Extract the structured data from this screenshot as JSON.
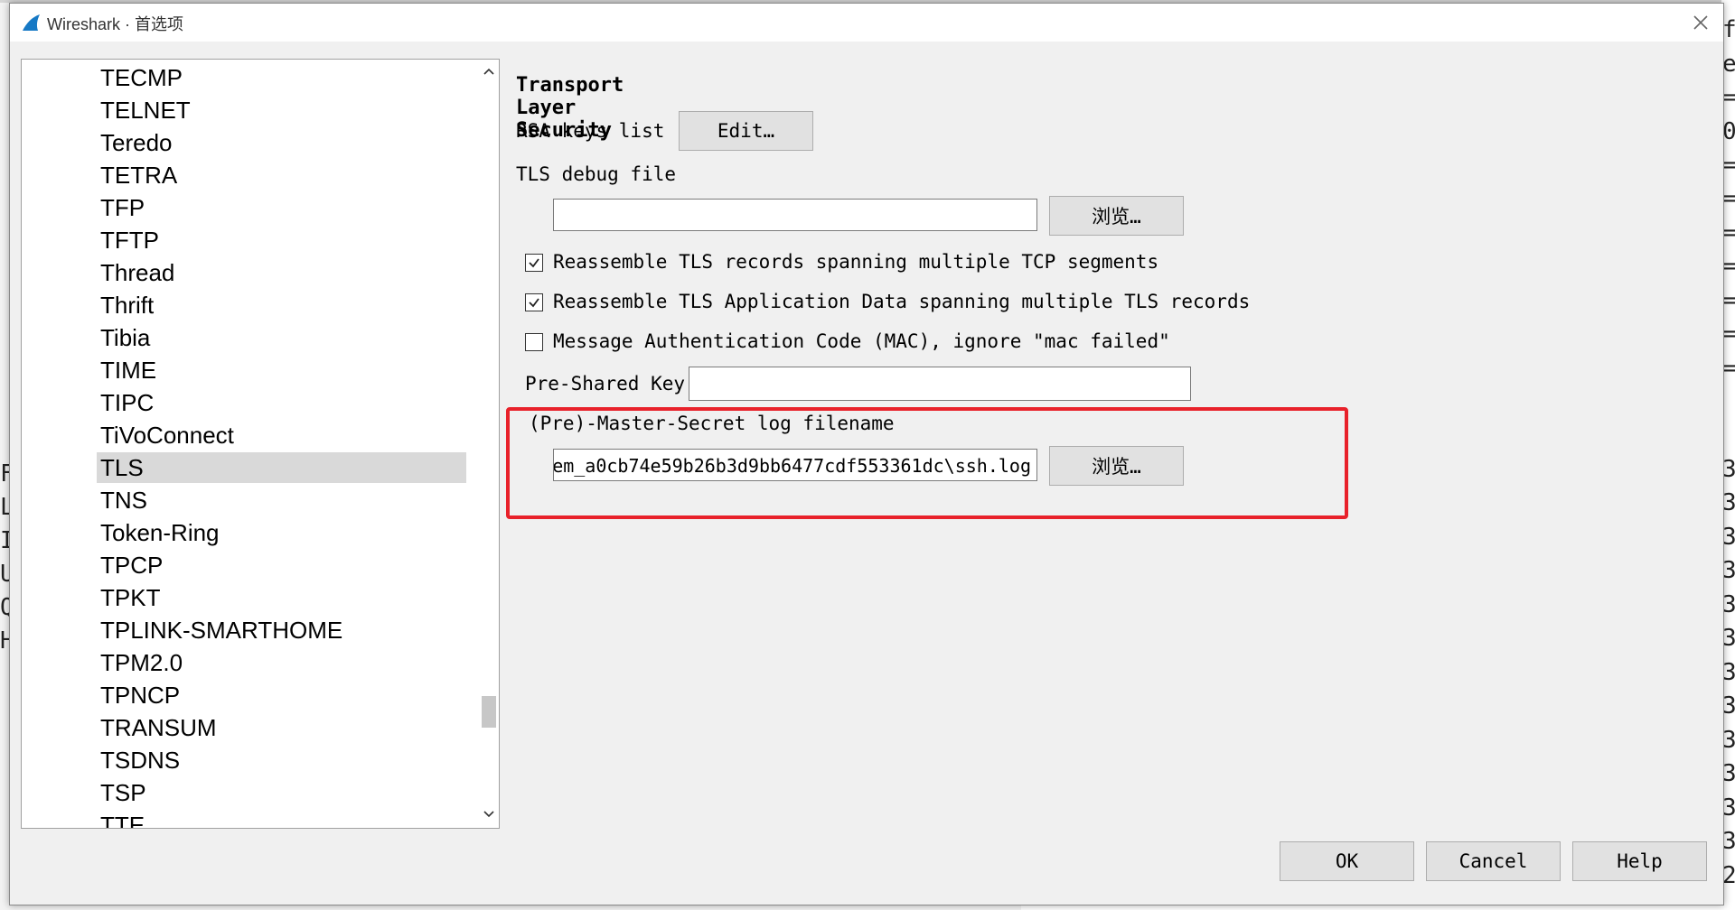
{
  "window": {
    "title": "Wireshark · 首选项"
  },
  "tree": {
    "items": [
      {
        "label": "TECMP"
      },
      {
        "label": "TELNET"
      },
      {
        "label": "Teredo"
      },
      {
        "label": "TETRA"
      },
      {
        "label": "TFP"
      },
      {
        "label": "TFTP"
      },
      {
        "label": "Thread"
      },
      {
        "label": "Thrift"
      },
      {
        "label": "Tibia"
      },
      {
        "label": "TIME"
      },
      {
        "label": "TIPC"
      },
      {
        "label": "TiVoConnect"
      },
      {
        "label": "TLS",
        "selected": true
      },
      {
        "label": "TNS"
      },
      {
        "label": "Token-Ring"
      },
      {
        "label": "TPCP"
      },
      {
        "label": "TPKT"
      },
      {
        "label": "TPLINK-SMARTHOME"
      },
      {
        "label": "TPM2.0"
      },
      {
        "label": "TPNCP"
      },
      {
        "label": "TRANSUM"
      },
      {
        "label": "TSDNS"
      },
      {
        "label": "TSP"
      },
      {
        "label": "TTE"
      }
    ]
  },
  "settings": {
    "section_title": "Transport Layer Security",
    "rsa_keys_label": "RSA keys list",
    "edit_button": "Edit…",
    "debug_file_label": "TLS debug file",
    "debug_file_value": "",
    "browse_button": "浏览…",
    "checkboxes": [
      {
        "label": "Reassemble TLS records spanning multiple TCP segments",
        "checked": true
      },
      {
        "label": "Reassemble TLS Application Data spanning multiple TLS records",
        "checked": true
      },
      {
        "label": "Message Authentication Code (MAC), ignore \"mac failed\"",
        "checked": false
      }
    ],
    "psk_label": "Pre-Shared Key",
    "psk_value": "",
    "master_secret_label": "(Pre)-Master-Secret log filename",
    "master_secret_value": "em_a0cb74e59b26b3d9bb6477cdf553361dc\\ssh.log"
  },
  "footer": {
    "ok": "OK",
    "cancel": "Cancel",
    "help": "Help"
  },
  "colors": {
    "highlight": "#e8212a",
    "selection": "#d9d9d9"
  }
}
